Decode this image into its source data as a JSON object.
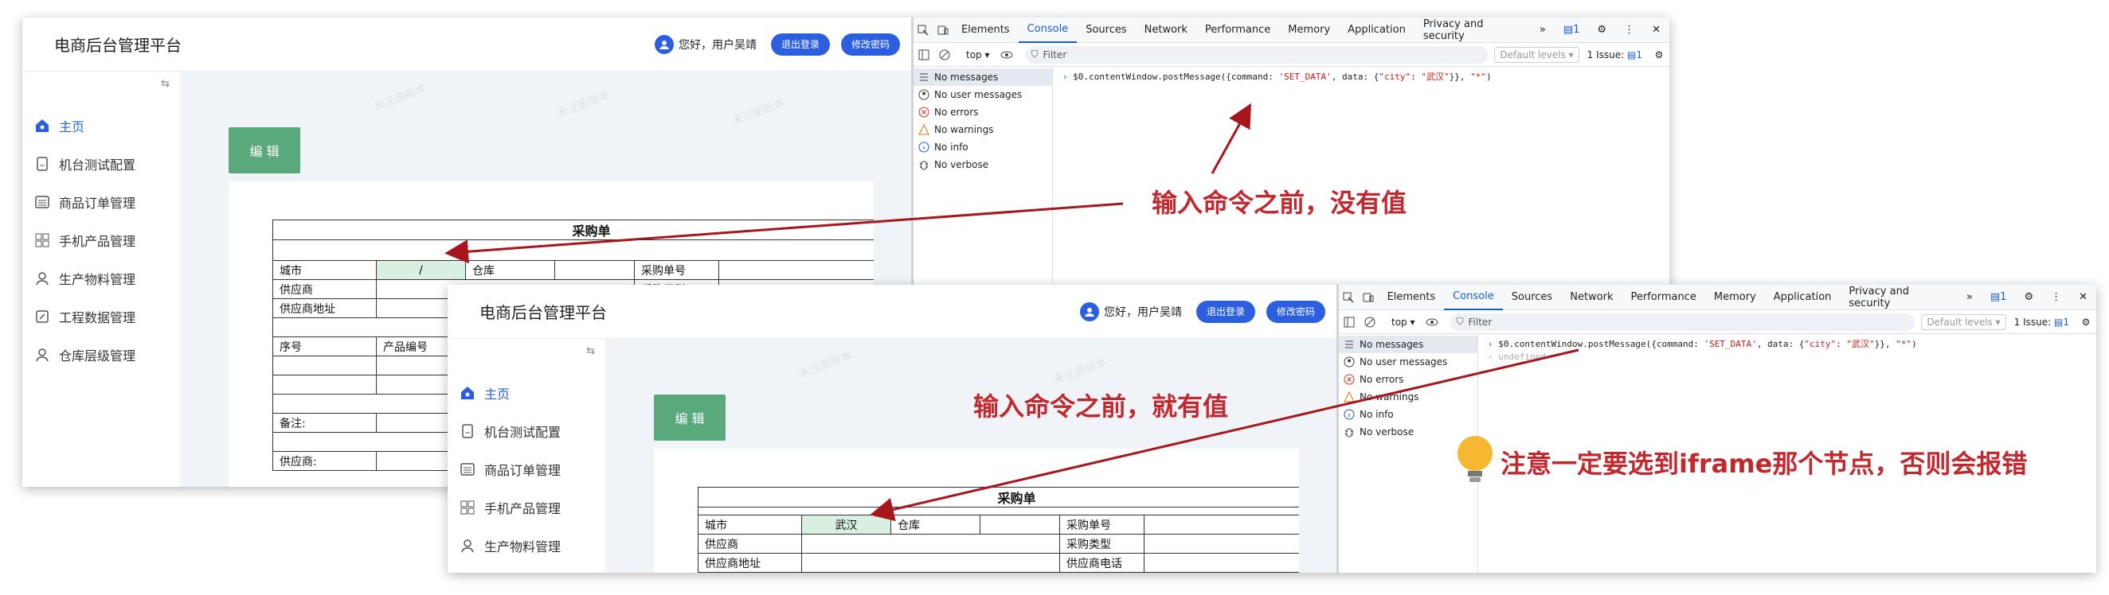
{
  "app": {
    "title": "电商后台管理平台",
    "greeting": "您好，用户吴靖",
    "logout": "退出登录",
    "change_password": "修改密码",
    "collapse_icon": "⇆",
    "menu": [
      {
        "label": "主页",
        "icon": "home-icon"
      },
      {
        "label": "机台测试配置",
        "icon": "file-icon"
      },
      {
        "label": "商品订单管理",
        "icon": "list-icon"
      },
      {
        "label": "手机产品管理",
        "icon": "grid-icon"
      },
      {
        "label": "生产物料管理",
        "icon": "user-icon"
      },
      {
        "label": "工程数据管理",
        "icon": "edit-icon"
      },
      {
        "label": "仓库层级管理",
        "icon": "user-icon"
      }
    ],
    "edit_button": "编 辑",
    "watermark": "未注册版本"
  },
  "form": {
    "title": "采购单",
    "city_label": "城市",
    "city_value_before": "/",
    "city_value_after": "武汉",
    "warehouse": "仓库",
    "po_number": "采购单号",
    "supplier": "供应商",
    "po_type": "采购类型",
    "supplier_addr": "供应商地址",
    "supplier_phone": "供应商电话",
    "seq": "序号",
    "product_no": "产品编号",
    "remark": "备注:",
    "supplier_sign": "供应商:"
  },
  "devtools": {
    "tabs": [
      "Elements",
      "Console",
      "Sources",
      "Network",
      "Performance",
      "Memory",
      "Application",
      "Privacy and security"
    ],
    "active_tab": "Console",
    "more": "»",
    "badge": "1",
    "context": "top ▾",
    "filter_placeholder": "Filter",
    "levels": "Default levels ▾",
    "issues": "1 Issue:",
    "issue_count": "1",
    "sidebar": [
      "No messages",
      "No user messages",
      "No errors",
      "No warnings",
      "No info",
      "No verbose"
    ],
    "command_prefix": "$0.contentWindow.postMessage({command: ",
    "cmd_str": "'SET_DATA'",
    "cmd_mid": ", data: {",
    "cmd_key": "\"city\"",
    "cmd_colon": ": ",
    "cmd_val": "\"武汉\"",
    "cmd_end": "}}, ",
    "cmd_star": "\"*\"",
    "cmd_close": ")",
    "undefined": "undefined"
  },
  "annotations": {
    "before_no_value": "输入命令之前，没有值",
    "before_has_value": "输入命令之前，就有值",
    "note": "注意一定要选到iframe那个节点，否则会报错"
  },
  "colors": {
    "accent": "#2b5fe0",
    "annotation": "#c1292e",
    "edit": "#5aa97d",
    "bulb": "#f5b830"
  }
}
